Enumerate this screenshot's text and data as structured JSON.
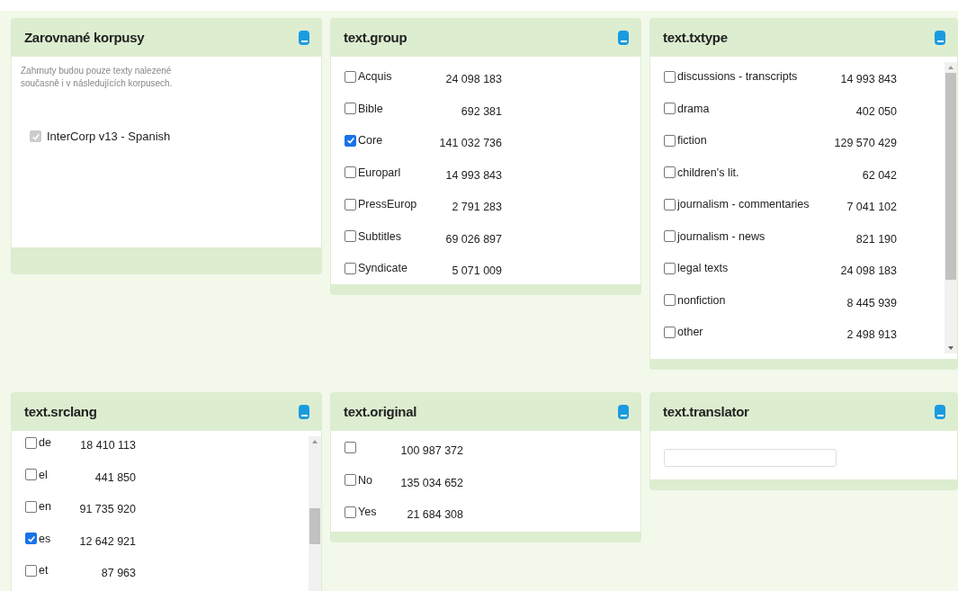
{
  "panels": [
    {
      "title": "Zarovnané korpusy",
      "kind": "aligned",
      "note": "Zahrnuty budou pouze texty nalezené současně i v následujících korpusech.",
      "items": [
        {
          "label": "InterCorp v13 - Spanish",
          "checked": true,
          "disabled": true
        }
      ]
    },
    {
      "title": "text.group",
      "kind": "checklist",
      "items": [
        {
          "label": "Acquis",
          "count": "24 098 183",
          "checked": false
        },
        {
          "label": "Bible",
          "count": "692 381",
          "checked": false
        },
        {
          "label": "Core",
          "count": "141 032 736",
          "checked": true
        },
        {
          "label": "Europarl",
          "count": "14 993 843",
          "checked": false
        },
        {
          "label": "PressEurop",
          "count": "2 791 283",
          "checked": false
        },
        {
          "label": "Subtitles",
          "count": "69 026 897",
          "checked": false
        },
        {
          "label": "Syndicate",
          "count": "5 071 009",
          "checked": false
        }
      ]
    },
    {
      "title": "text.txtype",
      "kind": "scroll_checklist",
      "items": [
        {
          "label": "discussions - transcripts",
          "count": "14 993 843",
          "checked": false
        },
        {
          "label": "drama",
          "count": "402 050",
          "checked": false
        },
        {
          "label": "fiction",
          "count": "129 570 429",
          "checked": false
        },
        {
          "label": "children's lit.",
          "count": "62 042",
          "checked": false
        },
        {
          "label": "journalism - commentaries",
          "count": "7 041 102",
          "checked": false
        },
        {
          "label": "journalism - news",
          "count": "821 190",
          "checked": false
        },
        {
          "label": "legal texts",
          "count": "24 098 183",
          "checked": false
        },
        {
          "label": "nonfiction",
          "count": "8 445 939",
          "checked": false
        },
        {
          "label": "other",
          "count": "2 498 913",
          "checked": false
        }
      ]
    },
    {
      "title": "text.srclang",
      "kind": "scroll_checklist",
      "items": [
        {
          "label": "de",
          "count": "18 410 113",
          "checked": false
        },
        {
          "label": "el",
          "count": "441 850",
          "checked": false
        },
        {
          "label": "en",
          "count": "91 735 920",
          "checked": false
        },
        {
          "label": "es",
          "count": "12 642 921",
          "checked": true
        },
        {
          "label": "et",
          "count": "87 963",
          "checked": false
        }
      ]
    },
    {
      "title": "text.original",
      "kind": "checklist",
      "items": [
        {
          "count": "100 987 372",
          "checked": false
        },
        {
          "label": "No",
          "count": "135 034 652",
          "checked": false
        },
        {
          "label": "Yes",
          "count": "21 684 308",
          "checked": false
        }
      ]
    },
    {
      "title": "text.translator",
      "kind": "text_input"
    }
  ]
}
